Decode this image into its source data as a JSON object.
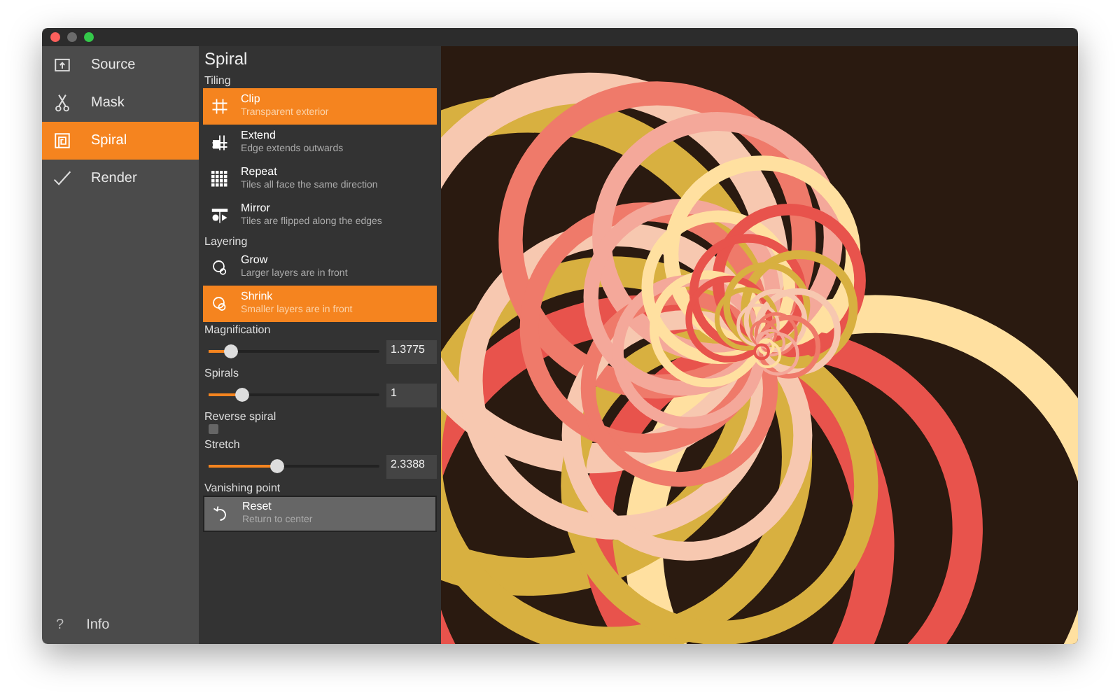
{
  "sidebar": {
    "items": [
      {
        "label": "Source",
        "selected": false
      },
      {
        "label": "Mask",
        "selected": false
      },
      {
        "label": "Spiral",
        "selected": true
      },
      {
        "label": "Render",
        "selected": false
      }
    ],
    "footer": {
      "icon": "?",
      "label": "Info"
    }
  },
  "panel": {
    "title": "Spiral",
    "tiling": {
      "heading": "Tiling",
      "options": [
        {
          "title": "Clip",
          "subtitle": "Transparent exterior",
          "selected": true
        },
        {
          "title": "Extend",
          "subtitle": "Edge extends outwards",
          "selected": false
        },
        {
          "title": "Repeat",
          "subtitle": "Tiles all face the same direction",
          "selected": false
        },
        {
          "title": "Mirror",
          "subtitle": "Tiles are flipped along the edges",
          "selected": false
        }
      ]
    },
    "layering": {
      "heading": "Layering",
      "options": [
        {
          "title": "Grow",
          "subtitle": "Larger layers are in front",
          "selected": false
        },
        {
          "title": "Shrink",
          "subtitle": "Smaller layers are in front",
          "selected": true
        }
      ]
    },
    "controls": [
      {
        "kind": "slider",
        "label": "Magnification",
        "level": 0.13,
        "value": "1.3775"
      },
      {
        "kind": "slider",
        "label": "Spirals",
        "level": 0.2,
        "value": "1"
      },
      {
        "kind": "checkbox",
        "label": "Reverse spiral",
        "checked": false
      },
      {
        "kind": "slider",
        "label": "Stretch",
        "level": 0.4,
        "value": "2.3388"
      }
    ],
    "vanishing": {
      "heading": "Vanishing point",
      "button": {
        "title": "Reset",
        "subtitle": "Return to center"
      }
    }
  }
}
